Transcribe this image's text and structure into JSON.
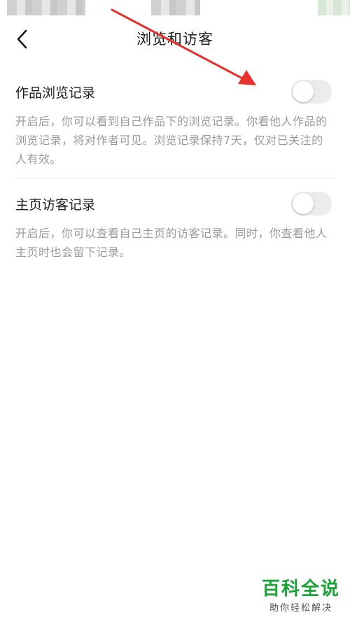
{
  "header": {
    "title": "浏览和访客",
    "back_icon": "chevron-left-icon"
  },
  "settings": [
    {
      "label": "作品浏览记录",
      "enabled": false,
      "description": "开启后，你可以看到自己作品下的浏览记录。你看他人作品的浏览记录，将对作者可见。浏览记录保持7天，仅对已关注的人有效。"
    },
    {
      "label": "主页访客记录",
      "enabled": false,
      "description": "开启后，你可以查看自己主页的访客记录。同时，你查看他人主页时也会留下记录。"
    }
  ],
  "watermark": {
    "main": "百科全说",
    "sub": "助你轻松解决"
  },
  "colors": {
    "annotation_arrow": "#e8302a",
    "toggle_off": "#ececec",
    "watermark_green": "#1aa336"
  }
}
